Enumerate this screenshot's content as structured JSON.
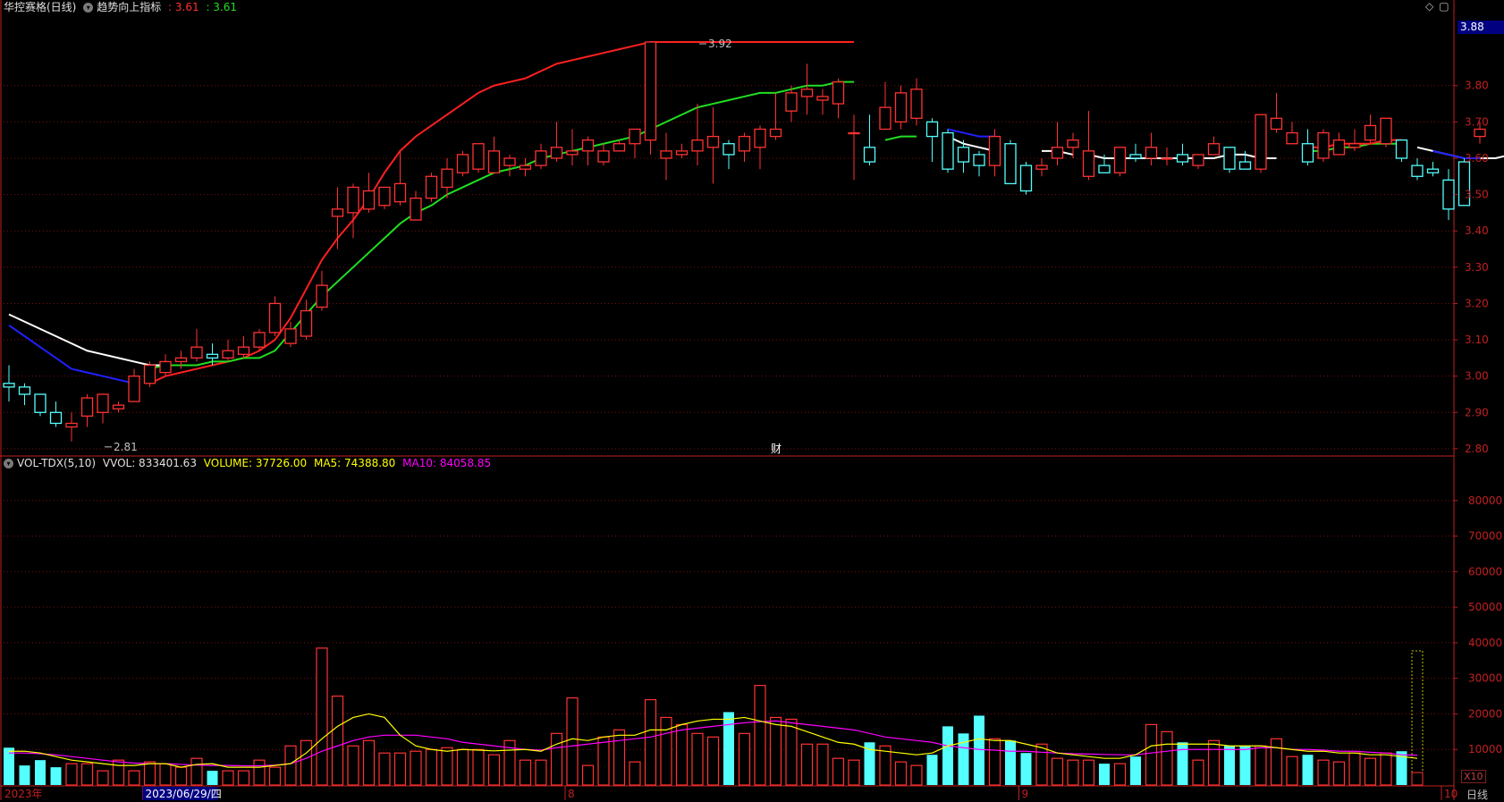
{
  "header": {
    "stock_name": "华控赛格(日线)",
    "indicator_name": "趋势向上指标",
    "indicator_value_1": ": 3.61",
    "indicator_value_2": ": 3.61"
  },
  "volume_header": {
    "indicator": "VOL-TDX(5,10)",
    "vvol": "VVOL: 833401.63",
    "volume": "VOLUME: 37726.00",
    "ma5": "MA5: 74388.80",
    "ma10": "MA10: 84058.85"
  },
  "last_price": "3.88",
  "toolbar": {
    "zoom_label": "X10",
    "period_label": "日线",
    "finance_marker": "财"
  },
  "colors": {
    "up": "#ff3232",
    "down": "#54ffff",
    "ma_red": "#ff2020",
    "ma_green": "#20e020",
    "ma_white": "#ffffff",
    "ma_blue": "#2020ff",
    "vol_ma5": "#ffff00",
    "vol_ma10": "#ff00ff",
    "grid": "#7a1010",
    "axis": "#c02020"
  },
  "chart_data": [
    {
      "type": "candlestick",
      "title": "华控赛格(日线)",
      "ylim": [
        2.75,
        3.92
      ],
      "y_ticks": [
        "3.80",
        "3.70",
        "3.60",
        "3.50",
        "3.40",
        "3.30",
        "3.20",
        "3.10",
        "3.00",
        "2.90",
        "2.80"
      ],
      "x_labels": [
        {
          "i": 0,
          "text": "2023年"
        },
        {
          "i": 9,
          "text": "2023/06/29/四"
        },
        {
          "i": 36,
          "text": "8"
        },
        {
          "i": 65,
          "text": "9"
        },
        {
          "i": 92,
          "text": "10"
        }
      ],
      "annotations": [
        {
          "i": 44,
          "price": 3.92,
          "text": "3.92"
        },
        {
          "i": 6,
          "price": 2.81,
          "text": "2.81"
        }
      ],
      "candles": [
        [
          2.98,
          2.97,
          3.03,
          2.93
        ],
        [
          2.97,
          2.95,
          2.98,
          2.92
        ],
        [
          2.95,
          2.9,
          2.95,
          2.89
        ],
        [
          2.9,
          2.87,
          2.93,
          2.86
        ],
        [
          2.86,
          2.87,
          2.9,
          2.82
        ],
        [
          2.89,
          2.94,
          2.95,
          2.86
        ],
        [
          2.9,
          2.95,
          2.95,
          2.87
        ],
        [
          2.91,
          2.92,
          2.93,
          2.9
        ],
        [
          2.93,
          3.0,
          3.02,
          2.93
        ],
        [
          2.98,
          3.03,
          3.04,
          2.97
        ],
        [
          3.01,
          3.04,
          3.06,
          3.0
        ],
        [
          3.04,
          3.05,
          3.07,
          3.02
        ],
        [
          3.05,
          3.08,
          3.13,
          3.04
        ],
        [
          3.06,
          3.05,
          3.09,
          3.03
        ],
        [
          3.05,
          3.07,
          3.1,
          3.04
        ],
        [
          3.06,
          3.08,
          3.11,
          3.05
        ],
        [
          3.08,
          3.12,
          3.13,
          3.07
        ],
        [
          3.12,
          3.2,
          3.22,
          3.11
        ],
        [
          3.09,
          3.13,
          3.15,
          3.08
        ],
        [
          3.11,
          3.18,
          3.21,
          3.1
        ],
        [
          3.19,
          3.25,
          3.29,
          3.18
        ],
        [
          3.44,
          3.46,
          3.52,
          3.35
        ],
        [
          3.45,
          3.52,
          3.53,
          3.38
        ],
        [
          3.46,
          3.51,
          3.56,
          3.45
        ],
        [
          3.47,
          3.52,
          3.52,
          3.46
        ],
        [
          3.48,
          3.53,
          3.62,
          3.47
        ],
        [
          3.43,
          3.49,
          3.51,
          3.43
        ],
        [
          3.49,
          3.55,
          3.56,
          3.48
        ],
        [
          3.52,
          3.57,
          3.6,
          3.49
        ],
        [
          3.56,
          3.61,
          3.62,
          3.55
        ],
        [
          3.57,
          3.64,
          3.64,
          3.56
        ],
        [
          3.56,
          3.62,
          3.66,
          3.56
        ],
        [
          3.58,
          3.6,
          3.61,
          3.55
        ],
        [
          3.57,
          3.58,
          3.6,
          3.55
        ],
        [
          3.58,
          3.62,
          3.64,
          3.57
        ],
        [
          3.6,
          3.63,
          3.7,
          3.59
        ],
        [
          3.61,
          3.62,
          3.68,
          3.58
        ],
        [
          3.62,
          3.65,
          3.66,
          3.58
        ],
        [
          3.59,
          3.62,
          3.64,
          3.58
        ],
        [
          3.62,
          3.64,
          3.65,
          3.62
        ],
        [
          3.64,
          3.68,
          3.68,
          3.6
        ],
        [
          3.65,
          3.92,
          3.92,
          3.61
        ],
        [
          3.6,
          3.62,
          3.67,
          3.54
        ],
        [
          3.61,
          3.62,
          3.64,
          3.6
        ],
        [
          3.62,
          3.65,
          3.75,
          3.58
        ],
        [
          3.63,
          3.66,
          3.74,
          3.53
        ],
        [
          3.64,
          3.61,
          3.65,
          3.57
        ],
        [
          3.62,
          3.66,
          3.67,
          3.59
        ],
        [
          3.63,
          3.68,
          3.69,
          3.57
        ],
        [
          3.66,
          3.68,
          3.78,
          3.65
        ],
        [
          3.73,
          3.78,
          3.8,
          3.7
        ],
        [
          3.77,
          3.79,
          3.86,
          3.72
        ],
        [
          3.76,
          3.77,
          3.79,
          3.72
        ],
        [
          3.75,
          3.81,
          3.82,
          3.71
        ],
        [
          3.67,
          3.67,
          3.72,
          3.54
        ],
        [
          3.63,
          3.59,
          3.72,
          3.58
        ],
        [
          3.68,
          3.74,
          3.81,
          3.68
        ],
        [
          3.7,
          3.78,
          3.8,
          3.68
        ],
        [
          3.71,
          3.79,
          3.82,
          3.69
        ],
        [
          3.7,
          3.66,
          3.71,
          3.59
        ],
        [
          3.67,
          3.57,
          3.68,
          3.56
        ],
        [
          3.63,
          3.59,
          3.65,
          3.56
        ],
        [
          3.61,
          3.58,
          3.62,
          3.55
        ],
        [
          3.58,
          3.66,
          3.68,
          3.55
        ],
        [
          3.64,
          3.53,
          3.65,
          3.53
        ],
        [
          3.58,
          3.51,
          3.59,
          3.5
        ],
        [
          3.57,
          3.58,
          3.6,
          3.55
        ],
        [
          3.6,
          3.63,
          3.7,
          3.58
        ],
        [
          3.63,
          3.65,
          3.67,
          3.6
        ],
        [
          3.55,
          3.62,
          3.73,
          3.54
        ],
        [
          3.58,
          3.56,
          3.61,
          3.56
        ],
        [
          3.56,
          3.63,
          3.63,
          3.55
        ],
        [
          3.61,
          3.6,
          3.64,
          3.59
        ],
        [
          3.6,
          3.63,
          3.67,
          3.58
        ],
        [
          3.6,
          3.6,
          3.63,
          3.58
        ],
        [
          3.61,
          3.59,
          3.64,
          3.58
        ],
        [
          3.58,
          3.61,
          3.61,
          3.57
        ],
        [
          3.61,
          3.64,
          3.66,
          3.61
        ],
        [
          3.63,
          3.57,
          3.63,
          3.56
        ],
        [
          3.59,
          3.57,
          3.62,
          3.57
        ],
        [
          3.57,
          3.72,
          3.72,
          3.56
        ],
        [
          3.68,
          3.71,
          3.78,
          3.67
        ],
        [
          3.64,
          3.67,
          3.7,
          3.64
        ],
        [
          3.64,
          3.59,
          3.68,
          3.58
        ],
        [
          3.6,
          3.67,
          3.68,
          3.59
        ],
        [
          3.61,
          3.65,
          3.67,
          3.61
        ],
        [
          3.63,
          3.64,
          3.68,
          3.62
        ],
        [
          3.65,
          3.69,
          3.72,
          3.64
        ],
        [
          3.64,
          3.71,
          3.71,
          3.63
        ],
        [
          3.65,
          3.6,
          3.65,
          3.59
        ],
        [
          3.58,
          3.55,
          3.6,
          3.54
        ],
        [
          3.57,
          3.56,
          3.59,
          3.55
        ],
        [
          3.54,
          3.46,
          3.57,
          3.43
        ],
        [
          3.59,
          3.47,
          3.6,
          3.47
        ],
        [
          3.66,
          3.68,
          3.7,
          3.64
        ]
      ],
      "series": [
        {
          "name": "red",
          "color": "#ff2020",
          "from": 9,
          "values": [
            2.98,
            3.0,
            3.01,
            3.02,
            3.03,
            3.04,
            3.05,
            3.07,
            3.1,
            3.16,
            3.24,
            3.32,
            3.38,
            3.43,
            3.49,
            3.56,
            3.62,
            3.66,
            3.69,
            3.72,
            3.75,
            3.78,
            3.8,
            3.81,
            3.82,
            3.84,
            3.86,
            3.87,
            3.88,
            3.89,
            3.9,
            3.91,
            3.93,
            3.95,
            3.96,
            3.97,
            3.99,
            4.01,
            4.04,
            4.06,
            4.08,
            4.1,
            4.11,
            4.12,
            4.13,
            4.14
          ]
        },
        {
          "name": "green",
          "color": "#20e020",
          "from": 9,
          "values": [
            3.02,
            3.03,
            3.03,
            3.03,
            3.04,
            3.04,
            3.05,
            3.05,
            3.07,
            3.12,
            3.17,
            3.22,
            3.26,
            3.3,
            3.34,
            3.38,
            3.42,
            3.45,
            3.47,
            3.5,
            3.52,
            3.54,
            3.56,
            3.57,
            3.58,
            3.6,
            3.61,
            3.62,
            3.63,
            3.64,
            3.65,
            3.66,
            3.68,
            3.7,
            3.72,
            3.74,
            3.75,
            3.76,
            3.77,
            3.78,
            3.78,
            3.79,
            3.8,
            3.8,
            3.81,
            3.81
          ]
        },
        {
          "name": "white",
          "color": "#ffffff",
          "from": 0,
          "values": [
            3.17,
            3.15,
            3.13,
            3.11,
            3.09,
            3.07,
            3.06,
            3.05,
            3.04,
            3.03,
            3.03
          ]
        },
        {
          "name": "blue",
          "color": "#2020ff",
          "from": 0,
          "values": [
            3.14,
            3.11,
            3.08,
            3.05,
            3.02,
            3.01,
            3.0,
            2.99,
            2.98
          ]
        }
      ],
      "segments": [
        {
          "color": "#20e020",
          "from": 56,
          "values": [
            3.65,
            3.66,
            3.66
          ]
        },
        {
          "color": "#ffffff",
          "from": 60,
          "values": [
            3.66,
            3.64,
            3.63,
            3.62
          ]
        },
        {
          "color": "#2020ff",
          "from": 60,
          "values": [
            3.68,
            3.67,
            3.66,
            3.66
          ]
        },
        {
          "color": "#ffffff",
          "from": 66,
          "values": [
            3.62,
            3.62,
            3.61
          ]
        },
        {
          "color": "#ffffff",
          "from": 69,
          "values": [
            3.61,
            3.6,
            3.6,
            3.6,
            3.6,
            3.6,
            3.6,
            3.6,
            3.6,
            3.61,
            3.61,
            3.6,
            3.6
          ]
        },
        {
          "color": "#20e020",
          "from": 83,
          "values": [
            3.62,
            3.62,
            3.63,
            3.63,
            3.64,
            3.64,
            3.64
          ]
        },
        {
          "color": "#ff2020",
          "from": 83,
          "values": [
            3.63,
            3.63,
            3.64,
            3.64,
            3.64,
            3.65,
            3.65
          ]
        },
        {
          "color": "#ffffff",
          "from": 90,
          "values": [
            3.63,
            3.62,
            3.61,
            3.6,
            3.6,
            3.6,
            3.61
          ]
        },
        {
          "color": "#2020ff",
          "from": 91,
          "values": [
            3.62,
            3.61,
            3.6,
            3.6
          ]
        }
      ]
    },
    {
      "type": "bar",
      "title": "VOL-TDX(5,10)",
      "ylim": [
        0,
        88000
      ],
      "y_ticks": [
        10000,
        20000,
        30000,
        40000,
        50000,
        60000,
        70000,
        80000
      ],
      "volumes": [
        10500,
        5500,
        7000,
        5000,
        6000,
        6000,
        4000,
        7000,
        4000,
        6500,
        6000,
        5000,
        7500,
        4000,
        4000,
        4000,
        7000,
        5000,
        11000,
        12500,
        38500,
        25000,
        11000,
        12500,
        9000,
        9000,
        9500,
        10000,
        10500,
        10000,
        10000,
        8500,
        12500,
        7000,
        7000,
        14500,
        24500,
        5500,
        13500,
        15500,
        6500,
        24000,
        19000,
        17000,
        14500,
        13500,
        20500,
        14500,
        28000,
        19000,
        18500,
        11500,
        11500,
        7500,
        7000,
        12000,
        11000,
        6500,
        5500,
        8500,
        16500,
        14500,
        19500,
        13000,
        12500,
        9000,
        11500,
        7500,
        7000,
        7000,
        6000,
        6000,
        8000,
        17000,
        15000,
        12000,
        7000,
        12500,
        11000,
        11000,
        11000,
        13000,
        8000,
        8500,
        7000,
        6500,
        9000,
        7500,
        9000,
        9500,
        37726
      ],
      "ma5": [
        9500,
        9500,
        9000,
        8000,
        7000,
        6500,
        6000,
        5500,
        5500,
        6000,
        6000,
        5000,
        5800,
        6000,
        5000,
        5000,
        5000,
        5500,
        6000,
        9000,
        13000,
        16500,
        19000,
        20000,
        19000,
        14000,
        11000,
        10000,
        9500,
        10000,
        9800,
        9600,
        9800,
        10000,
        9500,
        11500,
        13000,
        12500,
        13500,
        14000,
        14000,
        15500,
        15500,
        17000,
        18000,
        18500,
        18500,
        19000,
        18000,
        17000,
        16500,
        15000,
        13500,
        12000,
        11500,
        10000,
        9500,
        9000,
        8500,
        9000,
        11000,
        12000,
        13000,
        12500,
        12500,
        11500,
        10500,
        9000,
        8500,
        8000,
        7500,
        7500,
        8500,
        11000,
        11500,
        11500,
        11500,
        11500,
        11000,
        11000,
        11000,
        10500,
        10000,
        9500,
        9500,
        9000,
        9000,
        8500,
        8500,
        8000,
        7500
      ],
      "ma10": [
        9000,
        9000,
        8800,
        8500,
        8000,
        7500,
        7000,
        6500,
        6200,
        6000,
        6000,
        5800,
        5600,
        5500,
        5500,
        5400,
        5400,
        5600,
        6000,
        7500,
        9500,
        11000,
        12500,
        13500,
        14000,
        14000,
        14000,
        13500,
        13000,
        12000,
        11500,
        11000,
        10500,
        10000,
        9800,
        10500,
        11000,
        11500,
        12000,
        12500,
        13000,
        13500,
        14500,
        15500,
        16000,
        16500,
        17000,
        17500,
        17800,
        18000,
        17500,
        17000,
        16500,
        16000,
        15500,
        14500,
        13500,
        13000,
        12500,
        12000,
        11000,
        10500,
        10000,
        9800,
        9500,
        9500,
        9200,
        9000,
        8800,
        8700,
        8600,
        8500,
        8500,
        9000,
        9500,
        10000,
        10000,
        10000,
        10000,
        10000,
        10500,
        10500,
        10000,
        10000,
        9800,
        9500,
        9500,
        9200,
        9000,
        8500,
        8400
      ]
    }
  ]
}
